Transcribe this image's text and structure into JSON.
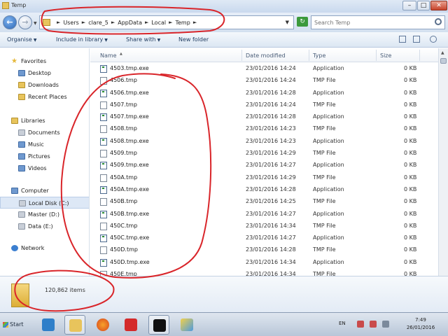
{
  "window": {
    "title": "Temp",
    "controls": {
      "minimize": "–",
      "maximize": "□",
      "close": "✕"
    }
  },
  "address_bar": {
    "crumbs": [
      "Users",
      "clare_5",
      "AppData",
      "Local",
      "Temp"
    ],
    "separator": "►",
    "dropdown_glyph": "▼",
    "refresh_glyph": "↻"
  },
  "search": {
    "placeholder": "Search Temp"
  },
  "toolbar": {
    "organise": "Organise",
    "include_in_library": "Include in library",
    "share_with": "Share with",
    "new_folder": "New folder"
  },
  "nav": {
    "favorites_header": "Favorites",
    "favorites": [
      "Desktop",
      "Downloads",
      "Recent Places"
    ],
    "libraries_header": "Libraries",
    "libraries": [
      "Documents",
      "Music",
      "Pictures",
      "Videos"
    ],
    "computer_header": "Computer",
    "drives": [
      "Local Disk (C:)",
      "Master (D:)",
      "Data (E:)"
    ],
    "network_header": "Network"
  },
  "columns": {
    "name": "Name",
    "date_modified": "Date modified",
    "type": "Type",
    "size": "Size"
  },
  "files": [
    {
      "name": "4503.tmp.exe",
      "date": "23/01/2016 14:24",
      "type": "Application",
      "size": "0 KB",
      "icon": "app-icon"
    },
    {
      "name": "4506.tmp",
      "date": "23/01/2016 14:24",
      "type": "TMP File",
      "size": "0 KB",
      "icon": "file-icon"
    },
    {
      "name": "4506.tmp.exe",
      "date": "23/01/2016 14:28",
      "type": "Application",
      "size": "0 KB",
      "icon": "app-icon"
    },
    {
      "name": "4507.tmp",
      "date": "23/01/2016 14:24",
      "type": "TMP File",
      "size": "0 KB",
      "icon": "file-icon"
    },
    {
      "name": "4507.tmp.exe",
      "date": "23/01/2016 14:28",
      "type": "Application",
      "size": "0 KB",
      "icon": "app-icon"
    },
    {
      "name": "4508.tmp",
      "date": "23/01/2016 14:23",
      "type": "TMP File",
      "size": "0 KB",
      "icon": "file-icon"
    },
    {
      "name": "4508.tmp.exe",
      "date": "23/01/2016 14:23",
      "type": "Application",
      "size": "0 KB",
      "icon": "app-icon"
    },
    {
      "name": "4509.tmp",
      "date": "23/01/2016 14:29",
      "type": "TMP File",
      "size": "0 KB",
      "icon": "file-icon"
    },
    {
      "name": "4509.tmp.exe",
      "date": "23/01/2016 14:27",
      "type": "Application",
      "size": "0 KB",
      "icon": "app-icon"
    },
    {
      "name": "450A.tmp",
      "date": "23/01/2016 14:29",
      "type": "TMP File",
      "size": "0 KB",
      "icon": "file-icon"
    },
    {
      "name": "450A.tmp.exe",
      "date": "23/01/2016 14:28",
      "type": "Application",
      "size": "0 KB",
      "icon": "app-icon"
    },
    {
      "name": "450B.tmp",
      "date": "23/01/2016 14:25",
      "type": "TMP File",
      "size": "0 KB",
      "icon": "file-icon"
    },
    {
      "name": "450B.tmp.exe",
      "date": "23/01/2016 14:27",
      "type": "Application",
      "size": "0 KB",
      "icon": "app-icon"
    },
    {
      "name": "450C.tmp",
      "date": "23/01/2016 14:34",
      "type": "TMP File",
      "size": "0 KB",
      "icon": "file-icon"
    },
    {
      "name": "450C.tmp.exe",
      "date": "23/01/2016 14:27",
      "type": "Application",
      "size": "0 KB",
      "icon": "app-icon"
    },
    {
      "name": "450D.tmp",
      "date": "23/01/2016 14:28",
      "type": "TMP File",
      "size": "0 KB",
      "icon": "file-icon"
    },
    {
      "name": "450D.tmp.exe",
      "date": "23/01/2016 14:34",
      "type": "Application",
      "size": "0 KB",
      "icon": "app-icon"
    },
    {
      "name": "450E.tmp",
      "date": "23/01/2016 14:34",
      "type": "TMP File",
      "size": "0 KB",
      "icon": "file-icon"
    }
  ],
  "status": {
    "item_count": "120,862 items"
  },
  "taskbar": {
    "start_label": "Start",
    "apps": [
      "wifi-app-icon",
      "explorer-app-icon",
      "firefox-app-icon",
      "avira-app-icon",
      "cmd-app-icon",
      "paint-app-icon"
    ],
    "language": "EN",
    "time": "7:49",
    "date": "26/01/2016"
  },
  "colors": {
    "annotation_red": "#d9252a",
    "selection_blue": "#dde8f6",
    "chrome_blue": "#c9d9ee"
  }
}
